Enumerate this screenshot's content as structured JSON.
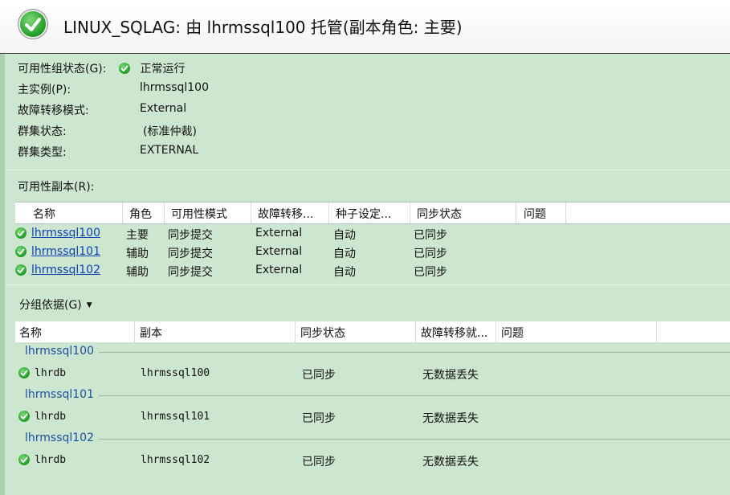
{
  "header": {
    "title": "LINUX_SQLAG: 由 lhrmssql100 托管(副本角色: 主要)"
  },
  "properties": [
    {
      "label": "可用性组状态(G):",
      "value": "正常运行"
    },
    {
      "label": "主实例(P):",
      "value": "lhrmssql100"
    },
    {
      "label": "故障转移模式:",
      "value": "External"
    },
    {
      "label": "群集状态:",
      "value": "(标准仲裁)"
    },
    {
      "label": "群集类型:",
      "value": "EXTERNAL"
    }
  ],
  "replicas": {
    "section_label": "可用性副本(R):",
    "columns": [
      "名称",
      "角色",
      "可用性模式",
      "故障转移...",
      "种子设定...",
      "同步状态",
      "问题"
    ],
    "rows": [
      {
        "name": "lhrmssql100",
        "role": "主要",
        "mode": "同步提交",
        "failover": "External",
        "seeding": "自动",
        "sync": "已同步"
      },
      {
        "name": "lhrmssql101",
        "role": "辅助",
        "mode": "同步提交",
        "failover": "External",
        "seeding": "自动",
        "sync": "已同步"
      },
      {
        "name": "lhrmssql102",
        "role": "辅助",
        "mode": "同步提交",
        "failover": "External",
        "seeding": "自动",
        "sync": "已同步"
      }
    ]
  },
  "databases": {
    "group_by_label": "分组依据(G)",
    "columns": [
      "名称",
      "副本",
      "同步状态",
      "故障转移就...",
      "问题"
    ],
    "groups": [
      {
        "title": "lhrmssql100",
        "db": "lhrdb",
        "replica": "lhrmssql100",
        "sync": "已同步",
        "failover": "无数据丢失"
      },
      {
        "title": "lhrmssql101",
        "db": "lhrdb",
        "replica": "lhrmssql101",
        "sync": "已同步",
        "failover": "无数据丢失"
      },
      {
        "title": "lhrmssql102",
        "db": "lhrdb",
        "replica": "lhrmssql102",
        "sync": "已同步",
        "failover": "无数据丢失"
      }
    ]
  },
  "colors": {
    "background": "#cde6cf",
    "status_ok": "#23a12a",
    "link": "#0a3fb7",
    "group_title": "#1e4fa0"
  }
}
